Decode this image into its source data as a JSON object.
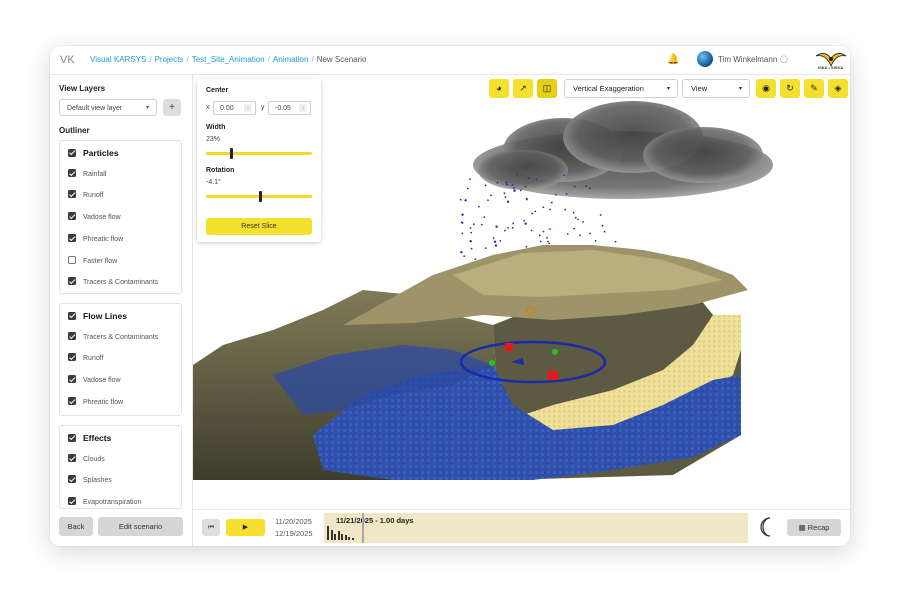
{
  "app": {
    "brand": "VK"
  },
  "breadcrumb": {
    "items": [
      "Visual KARSYS",
      "Projects",
      "Test_Site_Animation",
      "Animation"
    ],
    "current": "New Scenario",
    "sep": "/"
  },
  "header": {
    "user_name": "Tim Winkelmann",
    "logo_text": "ISKA • SISKA"
  },
  "sidebar": {
    "view_layers_title": "View Layers",
    "view_layer_select": "Default view layer",
    "add_label": "+",
    "outliner_title": "Outliner",
    "groups": [
      {
        "label": "Particles",
        "checked": true,
        "items": [
          {
            "label": "Rainfall",
            "checked": true
          },
          {
            "label": "Runoff",
            "checked": true
          },
          {
            "label": "Vadose flow",
            "checked": true
          },
          {
            "label": "Phreatic flow",
            "checked": true
          },
          {
            "label": "Faster flow",
            "checked": false
          },
          {
            "label": "Tracers & Contaminants",
            "checked": true
          }
        ]
      },
      {
        "label": "Flow Lines",
        "checked": true,
        "items": [
          {
            "label": "Tracers & Contaminants",
            "checked": true
          },
          {
            "label": "Runoff",
            "checked": true
          },
          {
            "label": "Vadose flow",
            "checked": true
          },
          {
            "label": "Phreatic flow",
            "checked": true
          }
        ]
      },
      {
        "label": "Effects",
        "checked": true,
        "items": [
          {
            "label": "Clouds",
            "checked": true
          },
          {
            "label": "Splashes",
            "checked": true
          },
          {
            "label": "Evapotranspiration",
            "checked": true
          }
        ]
      }
    ],
    "back_label": "Back",
    "edit_label": "Edit scenario"
  },
  "slice_panel": {
    "center_label": "Center",
    "x_label": "x",
    "x_value": "0.00",
    "y_label": "y",
    "y_value": "-0.05",
    "width_label": "Width",
    "width_value": "23%",
    "width_fraction": 0.23,
    "rotation_label": "Rotation",
    "rotation_value": "-4.1°",
    "rotation_fraction": 0.5,
    "reset_label": "Reset Slice"
  },
  "toolbar": {
    "vertical_exaggeration": "Vertical Exaggeration",
    "view": "View",
    "icons": [
      "gauge-icon",
      "chart-line-icon",
      "slice-icon",
      "camera-icon",
      "reset-icon",
      "paint-icon",
      "layers-icon"
    ]
  },
  "timeline": {
    "start_date": "11/20/2025",
    "end_date": "12/19/2025",
    "current": "11/21/2025 - 1.00 days",
    "play_label": "▶",
    "prev_label": "⏮",
    "recap_label": "Recap",
    "rain_bars": [
      0.9,
      0.6,
      0.35,
      0.55,
      0.4,
      0.3,
      0.2,
      0.15
    ]
  },
  "colors": {
    "accent": "#f6e02e",
    "link": "#1aa0d6",
    "water": "#2f4ea8",
    "sand": "#efe09a"
  }
}
